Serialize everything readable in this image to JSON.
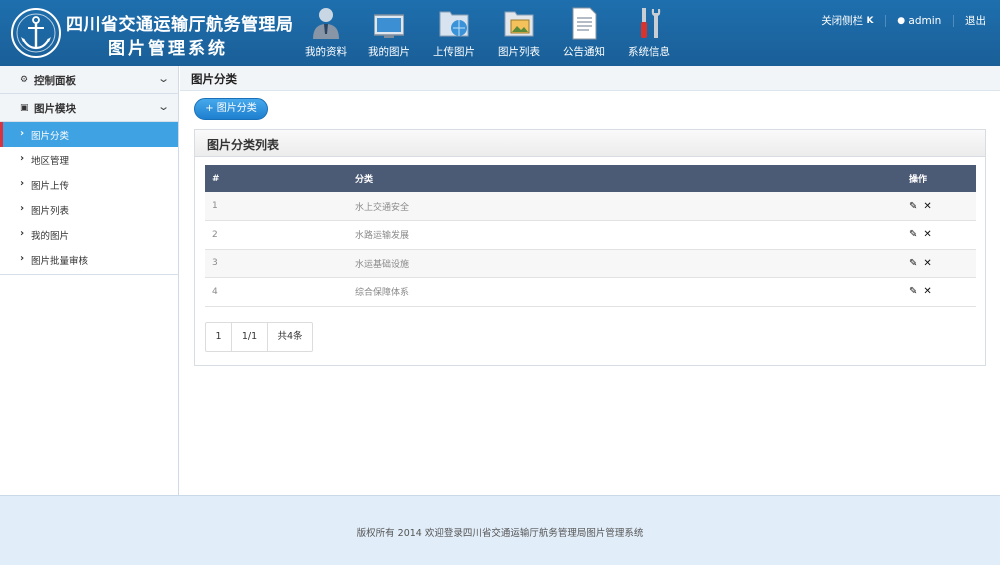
{
  "header": {
    "title_line1": "四川省交通运输厅航务管理局",
    "title_line2": "图片管理系统",
    "nav": [
      {
        "label": "我的资料",
        "icon": "user-icon"
      },
      {
        "label": "我的图片",
        "icon": "monitor-icon"
      },
      {
        "label": "上传图片",
        "icon": "folder-globe-icon"
      },
      {
        "label": "图片列表",
        "icon": "folder-image-icon"
      },
      {
        "label": "公告通知",
        "icon": "document-icon"
      },
      {
        "label": "系统信息",
        "icon": "tools-icon"
      }
    ],
    "close_sidebar": "关闭侧栏",
    "close_sidebar_icon": "K",
    "user": "admin",
    "logout": "退出"
  },
  "sidebar": {
    "sections": [
      {
        "label": "控制面板",
        "icon": "gear-icon"
      },
      {
        "label": "图片模块",
        "icon": "image-icon"
      }
    ],
    "items": [
      {
        "label": "图片分类",
        "active": true
      },
      {
        "label": "地区管理"
      },
      {
        "label": "图片上传"
      },
      {
        "label": "图片列表"
      },
      {
        "label": "我的图片"
      },
      {
        "label": "图片批量审核"
      }
    ]
  },
  "main": {
    "breadcrumb": "图片分类",
    "add_button": "+ 图片分类",
    "panel_title": "图片分类列表",
    "table": {
      "headers": [
        "#",
        "分类",
        "操作"
      ],
      "rows": [
        {
          "id": "1",
          "name": "水上交通安全"
        },
        {
          "id": "2",
          "name": "水路运输发展"
        },
        {
          "id": "3",
          "name": "水运基础设施"
        },
        {
          "id": "4",
          "name": "综合保障体系"
        }
      ]
    },
    "pager": {
      "page": "1",
      "pages": "1/1",
      "total": "共4条"
    }
  },
  "footer": {
    "text": "版权所有 2014 欢迎登录四川省交通运输厅航务管理局图片管理系统"
  },
  "colors": {
    "header": "#1e6fae",
    "active": "#3fa2e3",
    "table_head": "#4b5a75",
    "footer": "#e1edf8"
  }
}
